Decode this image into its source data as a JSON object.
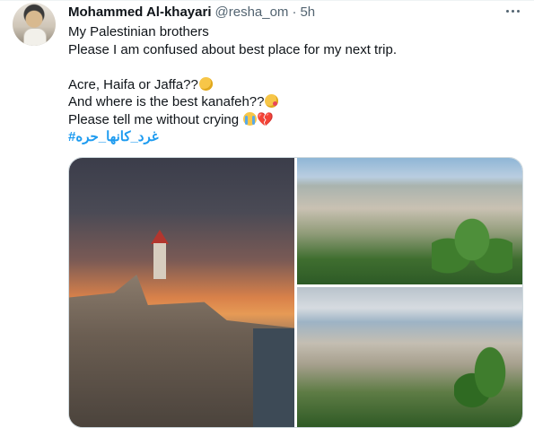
{
  "tweet": {
    "author_name": "Mohammed Al-khayari",
    "author_handle": "@resha_om",
    "separator": "·",
    "time": "5h",
    "lines": [
      "My Palestinian brothers",
      "Please I am confused about best place for my next trip."
    ],
    "line_acre": "Acre, Haifa or Jaffa??",
    "line_kanafeh": "And where is the best kanafeh??",
    "line_crying": "Please tell me without crying ",
    "hashtag": "#غرد_كانها_حره",
    "emoji": {
      "thinking": "thinking-face-icon",
      "yum": "face-savoring-food-icon",
      "crying": "loudly-crying-face-icon",
      "broken_heart": "💔"
    }
  },
  "media": {
    "photos": [
      {
        "label": "Acre sea wall at sunset photo"
      },
      {
        "label": "Haifa Bahai gardens view photo"
      },
      {
        "label": "Haifa bay panorama photo"
      }
    ]
  },
  "colors": {
    "link": "#1d9bf0",
    "secondary_text": "#536471",
    "primary_text": "#0f1419"
  }
}
